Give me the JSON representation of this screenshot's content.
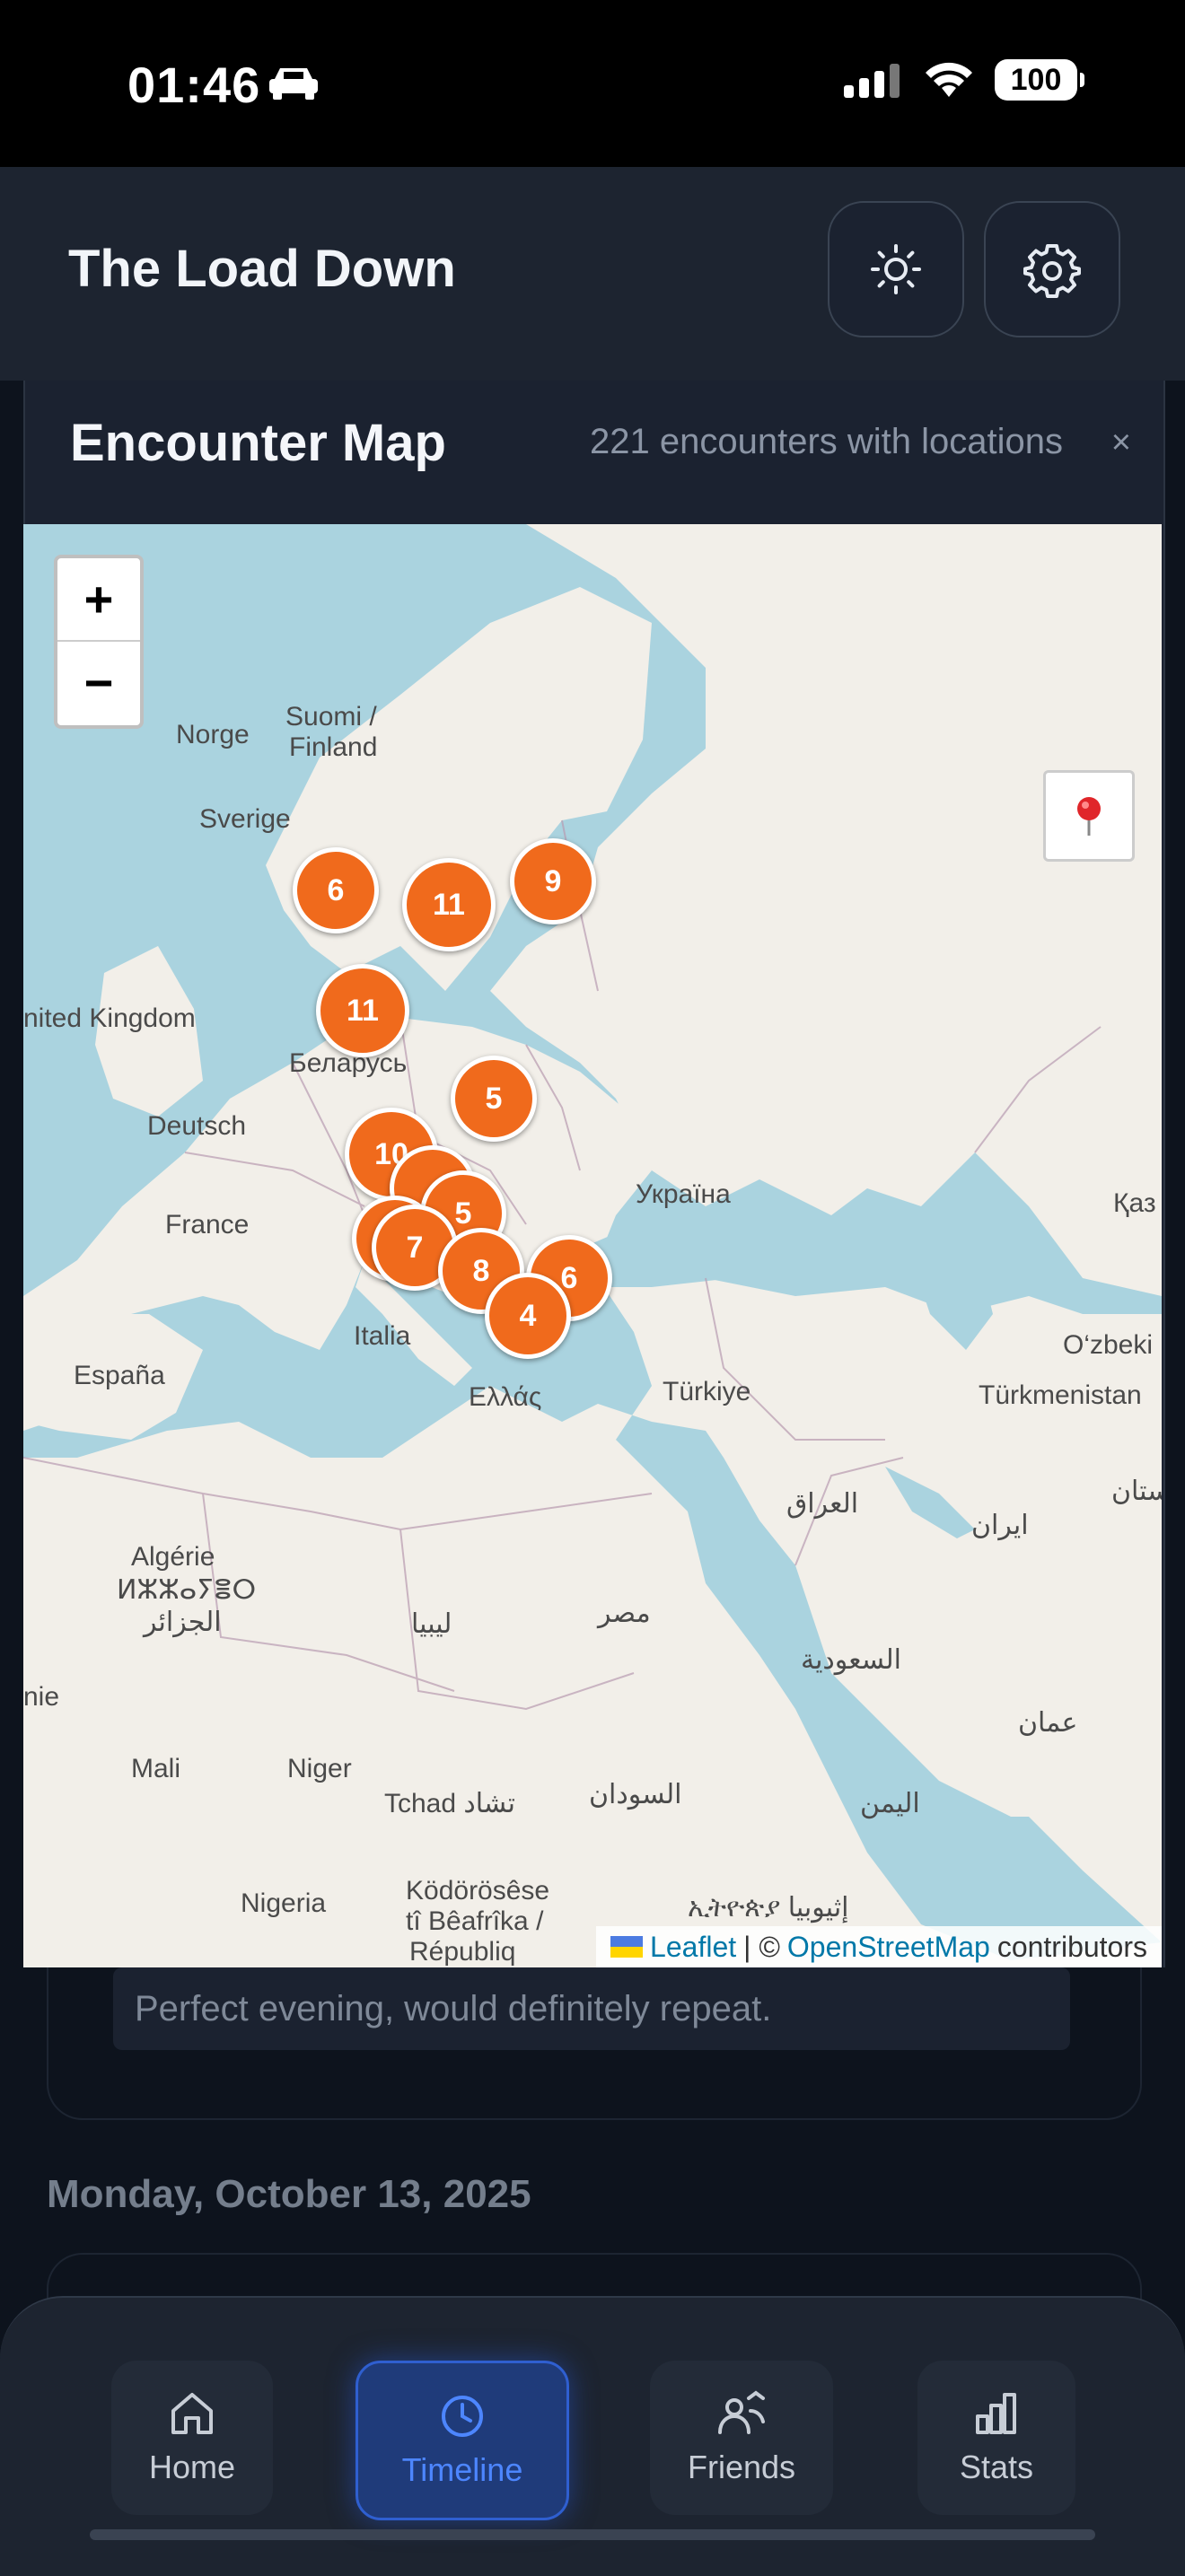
{
  "status": {
    "time": "01:46",
    "battery": "100"
  },
  "app": {
    "title": "The Load Down"
  },
  "modal": {
    "title": "Encounter Map",
    "subtitle": "221 encounters with locations",
    "close": "×"
  },
  "map": {
    "zoom_in": "+",
    "zoom_out": "−",
    "labels": {
      "norge": "Norge",
      "suomi1": "Suomi /",
      "suomi2": "Finland",
      "sverige": "Sverige",
      "uk": "nited Kingdom",
      "belarus": "Беларусь",
      "deutsch": "Deutsch",
      "ukraina": "Україна",
      "kaz": "Қаз",
      "france": "France",
      "italia": "Italia",
      "espana": "España",
      "ellas": "Ελλάς",
      "turkiye": "Türkiye",
      "ozbek": "O‘zbeki",
      "turkmen": "Türkmenistan",
      "iraq": "العراق",
      "iran": "ایران",
      "stan": "ستان",
      "algerie1": "Algérie",
      "algerie2": "ⵍⵣⵣⴰⵢⴻⵔ",
      "algerie3": "الجزائر",
      "libya": "ليبيا",
      "egypt": "مصر",
      "saudi": "السعودية",
      "oman": "عمان",
      "nie": "nie",
      "mali": "Mali",
      "niger": "Niger",
      "tchad": "Tchad تشاد",
      "sudan": "السودان",
      "yemen": "اليمن",
      "nigeria": "Nigeria",
      "kodo1": "Ködörösêse",
      "kodo2": "tî Bêafrîka /",
      "kodo3": "Républiq",
      "ethiopia": "ኢትዮጵያ إثيوبيا"
    },
    "clusters": [
      "6",
      "11",
      "9",
      "11",
      "5",
      "10",
      "5",
      "7",
      "8",
      "6",
      "4"
    ],
    "attribution": {
      "leaflet": "Leaflet",
      "sep": "| ©",
      "osm": "OpenStreetMap",
      "contrib": "contributors"
    }
  },
  "timeline": {
    "note": "Perfect evening, would definitely repeat.",
    "day": "Monday, October 13, 2025"
  },
  "tabs": [
    {
      "label": "Home",
      "icon": "home-icon"
    },
    {
      "label": "Timeline",
      "icon": "clock-icon"
    },
    {
      "label": "Friends",
      "icon": "friends-icon"
    },
    {
      "label": "Stats",
      "icon": "bar-chart-icon"
    }
  ],
  "colors": {
    "accent": "#2f5fd0",
    "cluster": "#f06a1c",
    "water": "#aad3df",
    "land": "#f2efe9"
  }
}
